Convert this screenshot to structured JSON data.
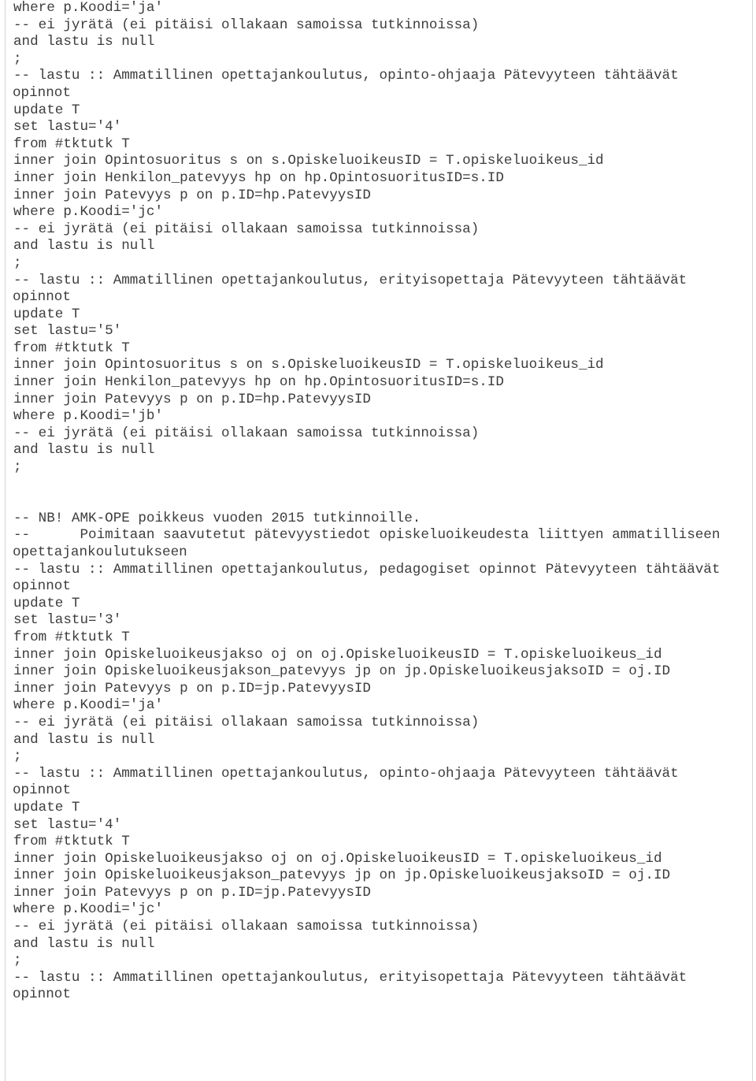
{
  "document": {
    "type": "sql-script",
    "language": "sql",
    "text_color": "#3d3d3d",
    "background_color": "#ffffff",
    "rule_color": "#d2d4d6",
    "lines": [
      {
        "text": "where p.Koodi='ja'",
        "wrapped": false
      },
      {
        "text": "-- ei jyrätä (ei pitäisi ollakaan samoissa tutkinnoissa)",
        "wrapped": false
      },
      {
        "text": "and lastu is null",
        "wrapped": false
      },
      {
        "text": ";",
        "wrapped": false
      },
      {
        "text": "-- lastu :: Ammatillinen opettajankoulutus, opinto-ohjaaja Pätevyyteen tähtäävät",
        "wrapped": false
      },
      {
        "text": "opinnot",
        "wrapped": true
      },
      {
        "text": "update T",
        "wrapped": false
      },
      {
        "text": "set lastu='4'",
        "wrapped": false
      },
      {
        "text": "from #tktutk T",
        "wrapped": false
      },
      {
        "text": "inner join Opintosuoritus s on s.OpiskeluoikeusID = T.opiskeluoikeus_id",
        "wrapped": false
      },
      {
        "text": "inner join Henkilon_patevyys hp on hp.OpintosuoritusID=s.ID",
        "wrapped": false
      },
      {
        "text": "inner join Patevyys p on p.ID=hp.PatevyysID",
        "wrapped": false
      },
      {
        "text": "where p.Koodi='jc'",
        "wrapped": false
      },
      {
        "text": "-- ei jyrätä (ei pitäisi ollakaan samoissa tutkinnoissa)",
        "wrapped": false
      },
      {
        "text": "and lastu is null",
        "wrapped": false
      },
      {
        "text": ";",
        "wrapped": false
      },
      {
        "text": "-- lastu :: Ammatillinen opettajankoulutus, erityisopettaja Pätevyyteen tähtäävät",
        "wrapped": false
      },
      {
        "text": "opinnot",
        "wrapped": true
      },
      {
        "text": "update T",
        "wrapped": false
      },
      {
        "text": "set lastu='5'",
        "wrapped": false
      },
      {
        "text": "from #tktutk T",
        "wrapped": false
      },
      {
        "text": "inner join Opintosuoritus s on s.OpiskeluoikeusID = T.opiskeluoikeus_id",
        "wrapped": false
      },
      {
        "text": "inner join Henkilon_patevyys hp on hp.OpintosuoritusID=s.ID",
        "wrapped": false
      },
      {
        "text": "inner join Patevyys p on p.ID=hp.PatevyysID",
        "wrapped": false
      },
      {
        "text": "where p.Koodi='jb'",
        "wrapped": false
      },
      {
        "text": "-- ei jyrätä (ei pitäisi ollakaan samoissa tutkinnoissa)",
        "wrapped": false
      },
      {
        "text": "and lastu is null",
        "wrapped": false
      },
      {
        "text": ";",
        "wrapped": false
      },
      {
        "text": "",
        "wrapped": false
      },
      {
        "text": "",
        "wrapped": false
      },
      {
        "text": "-- NB! AMK-OPE poikkeus vuoden 2015 tutkinnoille.",
        "wrapped": false
      },
      {
        "text": "--      Poimitaan saavutetut pätevyystiedot opiskeluoikeudesta liittyen ammatilliseen",
        "wrapped": false
      },
      {
        "text": "opettajankoulutukseen",
        "wrapped": true
      },
      {
        "text": "-- lastu :: Ammatillinen opettajankoulutus, pedagogiset opinnot Pätevyyteen tähtäävät",
        "wrapped": false
      },
      {
        "text": "opinnot",
        "wrapped": true
      },
      {
        "text": "update T",
        "wrapped": false
      },
      {
        "text": "set lastu='3'",
        "wrapped": false
      },
      {
        "text": "from #tktutk T",
        "wrapped": false
      },
      {
        "text": "inner join Opiskeluoikeusjakso oj on oj.OpiskeluoikeusID = T.opiskeluoikeus_id",
        "wrapped": false
      },
      {
        "text": "inner join Opiskeluoikeusjakson_patevyys jp on jp.OpiskeluoikeusjaksoID = oj.ID",
        "wrapped": false
      },
      {
        "text": "inner join Patevyys p on p.ID=jp.PatevyysID",
        "wrapped": false
      },
      {
        "text": "where p.Koodi='ja'",
        "wrapped": false
      },
      {
        "text": "-- ei jyrätä (ei pitäisi ollakaan samoissa tutkinnoissa)",
        "wrapped": false
      },
      {
        "text": "and lastu is null",
        "wrapped": false
      },
      {
        "text": ";",
        "wrapped": false
      },
      {
        "text": "-- lastu :: Ammatillinen opettajankoulutus, opinto-ohjaaja Pätevyyteen tähtäävät",
        "wrapped": false
      },
      {
        "text": "opinnot",
        "wrapped": true
      },
      {
        "text": "update T",
        "wrapped": false
      },
      {
        "text": "set lastu='4'",
        "wrapped": false
      },
      {
        "text": "from #tktutk T",
        "wrapped": false
      },
      {
        "text": "inner join Opiskeluoikeusjakso oj on oj.OpiskeluoikeusID = T.opiskeluoikeus_id",
        "wrapped": false
      },
      {
        "text": "inner join Opiskeluoikeusjakson_patevyys jp on jp.OpiskeluoikeusjaksoID = oj.ID",
        "wrapped": false
      },
      {
        "text": "inner join Patevyys p on p.ID=jp.PatevyysID",
        "wrapped": false
      },
      {
        "text": "where p.Koodi='jc'",
        "wrapped": false
      },
      {
        "text": "-- ei jyrätä (ei pitäisi ollakaan samoissa tutkinnoissa)",
        "wrapped": false
      },
      {
        "text": "and lastu is null",
        "wrapped": false
      },
      {
        "text": ";",
        "wrapped": false
      },
      {
        "text": "-- lastu :: Ammatillinen opettajankoulutus, erityisopettaja Pätevyyteen tähtäävät",
        "wrapped": false
      },
      {
        "text": "opinnot",
        "wrapped": true
      }
    ]
  }
}
